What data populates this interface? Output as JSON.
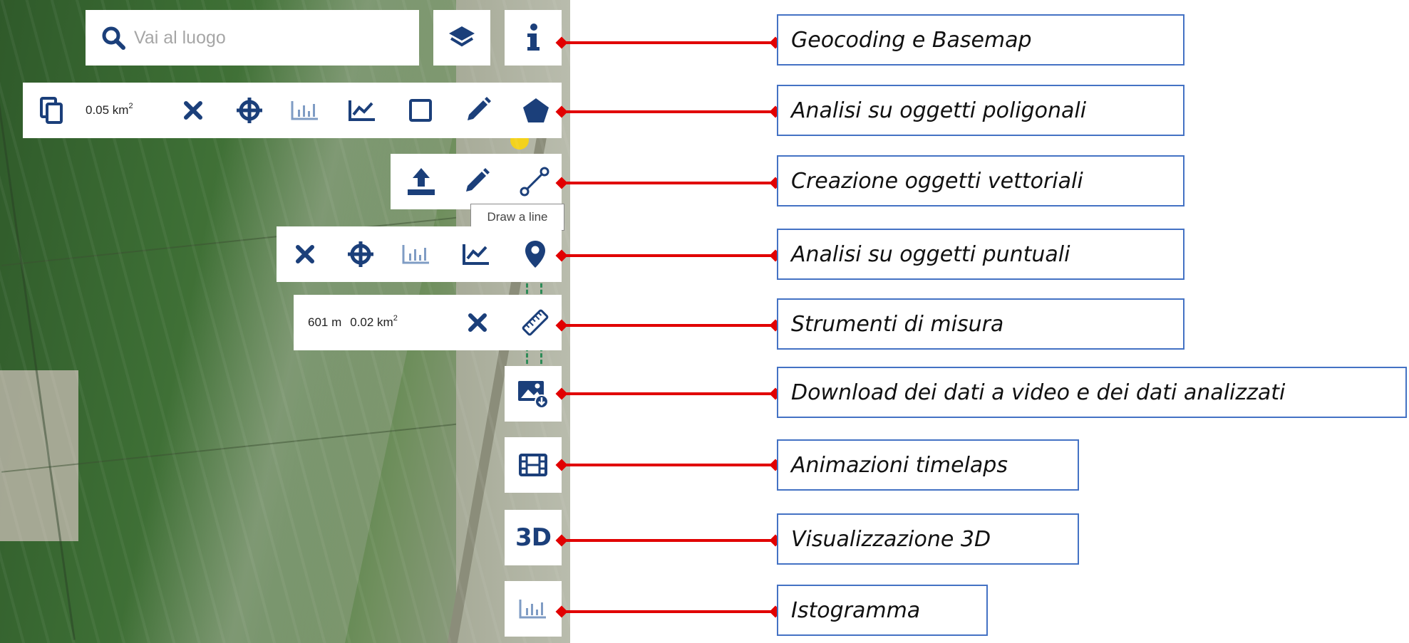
{
  "search": {
    "placeholder": "Vai al luogo"
  },
  "polygon_toolbar": {
    "area_value": "0.05 km",
    "area_sup": "2"
  },
  "tooltip": {
    "text": "Draw a line"
  },
  "measure_toolbar": {
    "length_value": "601 m",
    "area_value": "0.02 km",
    "area_sup": "2"
  },
  "buttons": {
    "three_d_label": "3D"
  },
  "callouts": [
    "Geocoding e Basemap",
    "Analisi su oggetti poligonali",
    "Creazione oggetti vettoriali",
    "Analisi su oggetti puntuali",
    "Strumenti di misura",
    "Download dei dati a video e dei dati analizzati",
    "Animazioni timelaps",
    "Visualizzazione 3D",
    "Istogramma"
  ],
  "colors": {
    "icon": "#1b3f7a",
    "icon_muted": "#7f9cc4",
    "arrow": "#e10000",
    "callout_border": "#4472c4"
  }
}
